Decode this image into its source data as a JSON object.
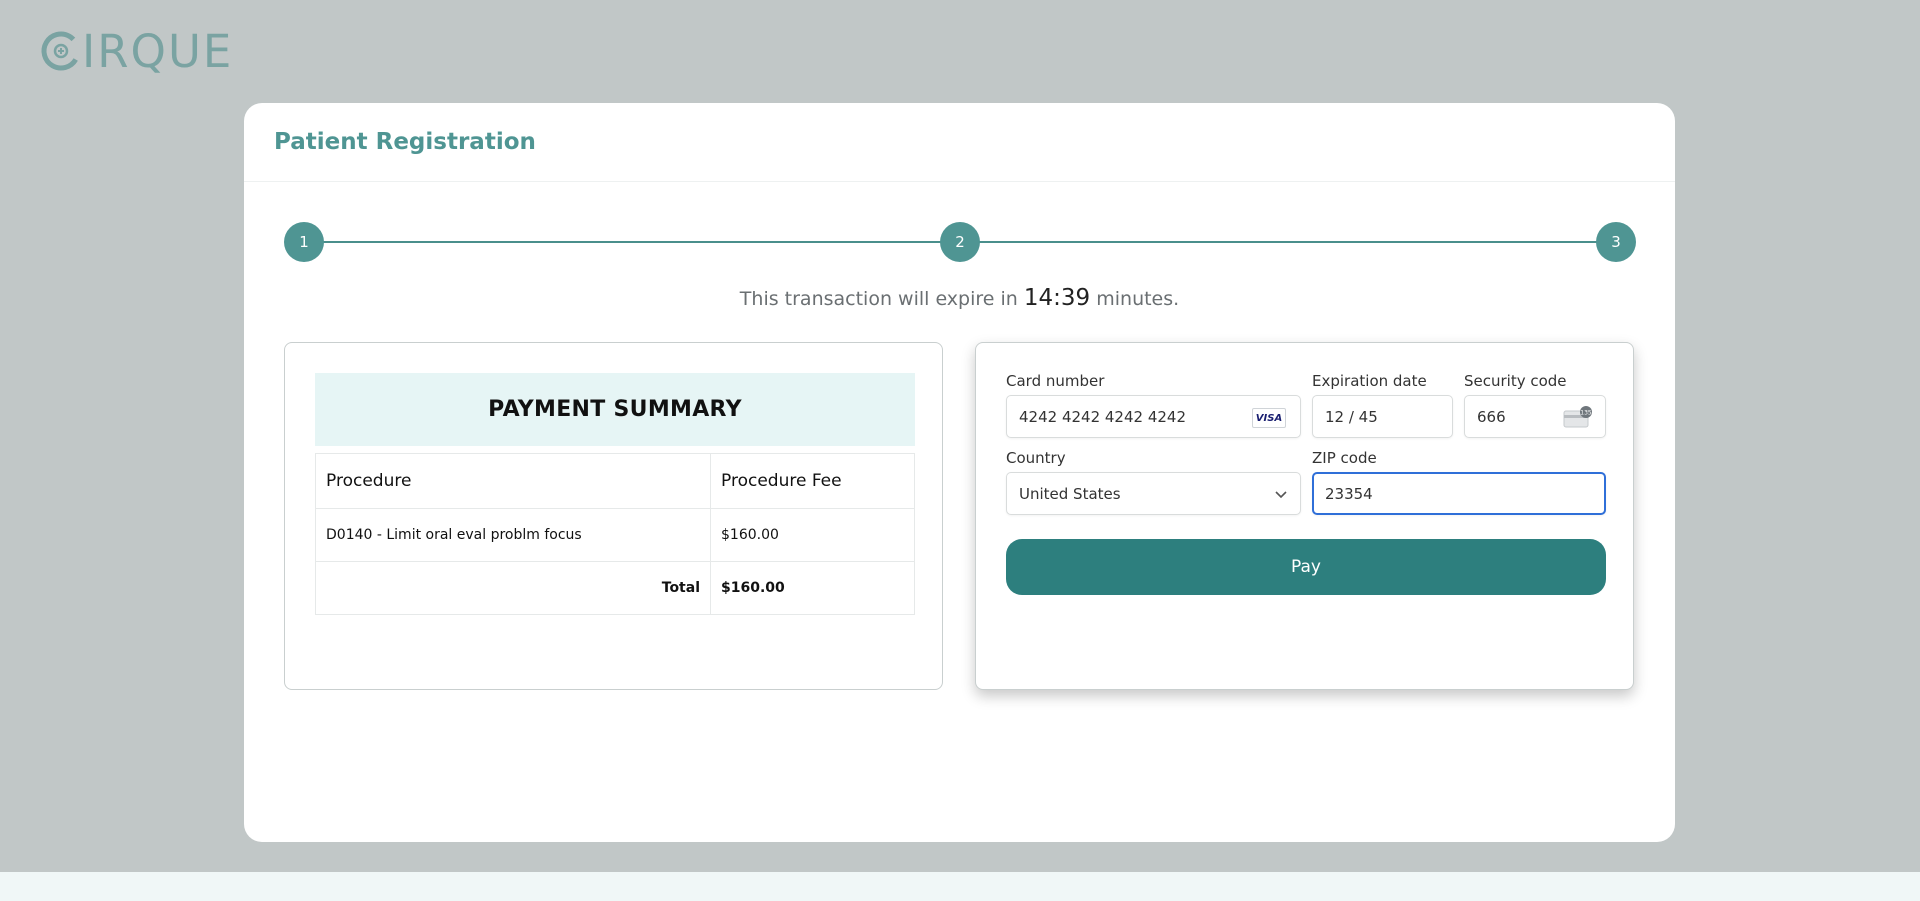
{
  "brand": {
    "logo_text": "IRQUE"
  },
  "header": {
    "title": "Patient Registration"
  },
  "steps": [
    "1",
    "2",
    "3"
  ],
  "expiry": {
    "prefix": "This transaction will expire in",
    "time": "14:39",
    "suffix": "minutes."
  },
  "summary": {
    "title": "PAYMENT SUMMARY",
    "columns": [
      "Procedure",
      "Procedure Fee"
    ],
    "rows": [
      {
        "procedure": "D0140 - Limit oral eval problm focus",
        "fee": "$160.00"
      }
    ],
    "total_label": "Total",
    "total_value": "$160.00"
  },
  "payment": {
    "card_number_label": "Card number",
    "card_number_value": "4242 4242 4242 4242",
    "card_brand": "VISA",
    "expiration_label": "Expiration date",
    "expiration_value": "12 / 45",
    "security_label": "Security code",
    "security_value": "666",
    "country_label": "Country",
    "country_value": "United States",
    "zip_label": "ZIP code",
    "zip_value": "23354",
    "pay_label": "Pay"
  },
  "colors": {
    "brand": "#4f9593",
    "button": "#2d7f7e",
    "background": "#c1c7c7",
    "summary_header_bg": "#e6f5f5",
    "focus": "#2f6fd8"
  }
}
